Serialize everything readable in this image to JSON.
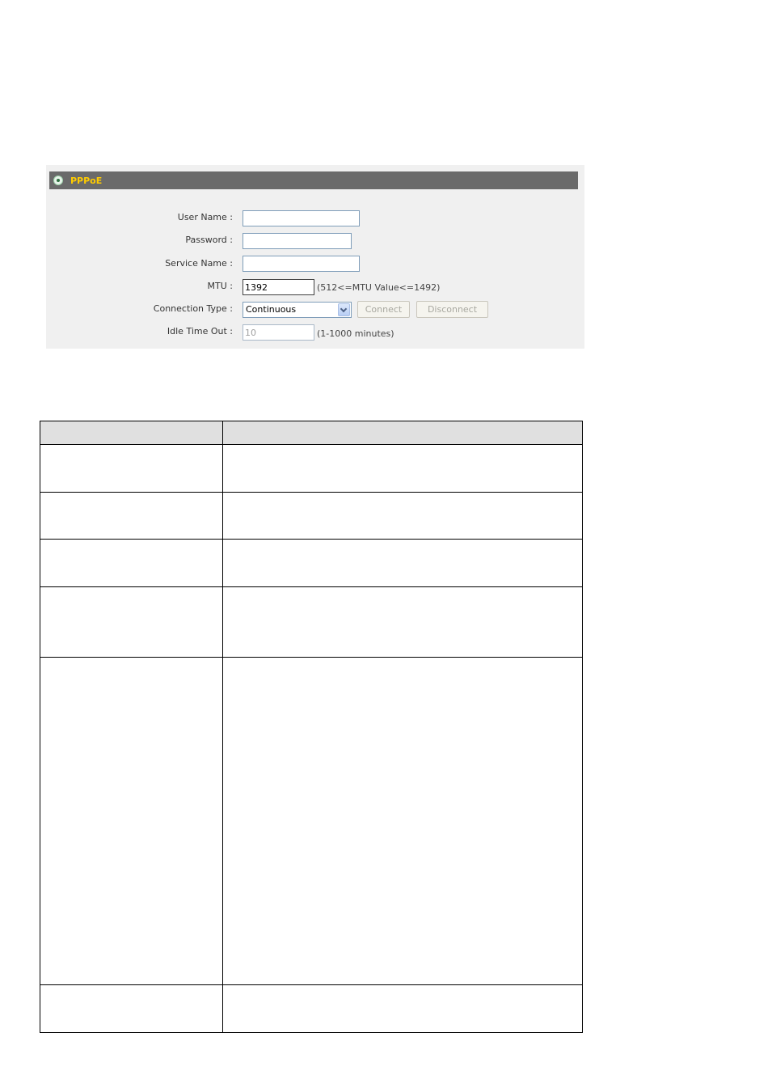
{
  "panel": {
    "title": "PPPoE",
    "header_icon": "settings-circle-icon",
    "fields": {
      "user_name": {
        "label": "User Name :",
        "value": ""
      },
      "password": {
        "label": "Password :",
        "value": ""
      },
      "service_name": {
        "label": "Service Name :",
        "value": ""
      },
      "mtu": {
        "label": "MTU :",
        "value": "1392",
        "hint": "(512<=MTU Value<=1492)"
      },
      "connection_type": {
        "label": "Connection Type :",
        "selected": "Continuous"
      },
      "idle_time_out": {
        "label": "Idle Time Out :",
        "value": "10",
        "hint": "(1-1000 minutes)"
      }
    },
    "buttons": {
      "connect": "Connect",
      "disconnect": "Disconnect"
    }
  },
  "table": {
    "headers": [
      "",
      ""
    ],
    "rows": [
      [
        "",
        ""
      ],
      [
        "",
        ""
      ],
      [
        "",
        ""
      ],
      [
        "",
        ""
      ],
      [
        "",
        ""
      ],
      [
        "",
        ""
      ]
    ]
  }
}
